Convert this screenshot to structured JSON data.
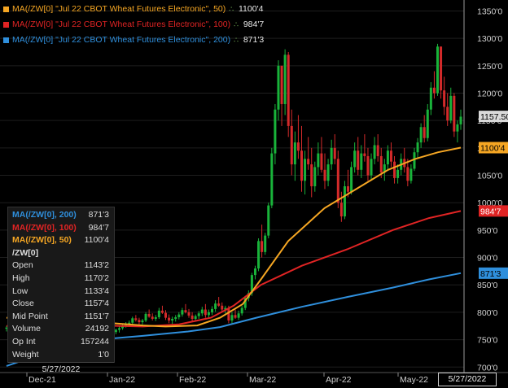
{
  "legend": [
    {
      "label": "MA(/ZW[0] \"Jul 22 CBOT Wheat Futures Electronic\", 50)",
      "value": "1100'4",
      "color": "#f5a623"
    },
    {
      "label": "MA(/ZW[0] \"Jul 22 CBOT Wheat Futures Electronic\", 100)",
      "value": "984'7",
      "color": "#e02424"
    },
    {
      "label": "MA(/ZW[0] \"Jul 22 CBOT Wheat Futures Electronic\", 200)",
      "value": "871'3",
      "color": "#2f8fdc"
    }
  ],
  "legend_icon": "settings-icon",
  "tooltip": {
    "ma200": {
      "label": "MA(/ZW[0], 200)",
      "value": "871'3",
      "color": "#2f8fdc"
    },
    "ma100": {
      "label": "MA(/ZW[0], 100)",
      "value": "984'7",
      "color": "#e02424"
    },
    "ma50": {
      "label": "MA(/ZW[0], 50)",
      "value": "1100'4",
      "color": "#f5a623"
    },
    "symbol": "/ZW[0]",
    "rows": [
      {
        "label": "Open",
        "value": "1143'2"
      },
      {
        "label": "High",
        "value": "1170'2"
      },
      {
        "label": "Low",
        "value": "1133'4"
      },
      {
        "label": "Close",
        "value": "1157'4"
      },
      {
        "label": "Mid Point",
        "value": "1151'7"
      },
      {
        "label": "Volume",
        "value": "24192"
      },
      {
        "label": "Op Int",
        "value": "157244"
      },
      {
        "label": "Weight",
        "value": "1'0"
      }
    ],
    "date": "5/27/2022"
  },
  "cursor_date": "5/27/2022",
  "chart_data": {
    "type": "candlestick",
    "y_ticks": [
      "700'0",
      "750'0",
      "800'0",
      "850'0",
      "900'0",
      "950'0",
      "1000'0",
      "1050'0",
      "1100'0",
      "1150'0",
      "1200'0",
      "1250'0",
      "1300'0",
      "1350'0"
    ],
    "ylim": [
      690,
      1370
    ],
    "x_ticks": [
      "Dec-21",
      "Jan-22",
      "Feb-22",
      "Mar-22",
      "Apr-22",
      "May-22"
    ],
    "price_tags": [
      {
        "label": "1157.50",
        "value": 1157.5,
        "color": "#d9d9d9",
        "text_color": "#000"
      },
      {
        "label": "1100'4",
        "value": 1100.5,
        "color": "#f5a623",
        "text_color": "#000"
      },
      {
        "label": "984'7",
        "value": 984.9,
        "color": "#e02424",
        "text_color": "#fff"
      },
      {
        "label": "871'3",
        "value": 871.4,
        "color": "#2f8fdc",
        "text_color": "#000"
      }
    ],
    "candles": [
      [
        770,
        775,
        765,
        772
      ],
      [
        772,
        778,
        768,
        775
      ],
      [
        775,
        780,
        770,
        773
      ],
      [
        773,
        776,
        768,
        771
      ],
      [
        771,
        777,
        767,
        774
      ],
      [
        774,
        782,
        771,
        779
      ],
      [
        779,
        784,
        774,
        776
      ],
      [
        776,
        781,
        771,
        778
      ],
      [
        778,
        786,
        776,
        783
      ],
      [
        783,
        787,
        776,
        779
      ],
      [
        779,
        784,
        772,
        775
      ],
      [
        775,
        780,
        770,
        777
      ],
      [
        777,
        779,
        766,
        768
      ],
      [
        768,
        773,
        762,
        771
      ],
      [
        771,
        777,
        768,
        775
      ],
      [
        775,
        779,
        768,
        770
      ],
      [
        770,
        774,
        760,
        762
      ],
      [
        762,
        770,
        758,
        768
      ],
      [
        768,
        775,
        764,
        772
      ],
      [
        772,
        776,
        762,
        765
      ],
      [
        765,
        768,
        752,
        755
      ],
      [
        755,
        762,
        750,
        760
      ],
      [
        760,
        766,
        755,
        763
      ],
      [
        763,
        770,
        760,
        766
      ],
      [
        766,
        770,
        756,
        758
      ],
      [
        758,
        764,
        752,
        761
      ],
      [
        761,
        768,
        758,
        765
      ],
      [
        765,
        772,
        762,
        769
      ],
      [
        769,
        772,
        760,
        763
      ],
      [
        763,
        770,
        760,
        767
      ],
      [
        767,
        771,
        752,
        755
      ],
      [
        755,
        760,
        748,
        758
      ],
      [
        758,
        766,
        755,
        764
      ],
      [
        764,
        770,
        760,
        768
      ],
      [
        768,
        774,
        763,
        771
      ],
      [
        771,
        778,
        768,
        775
      ],
      [
        775,
        782,
        772,
        779
      ],
      [
        779,
        785,
        775,
        781
      ],
      [
        781,
        792,
        778,
        789
      ],
      [
        789,
        795,
        783,
        786
      ],
      [
        786,
        790,
        778,
        782
      ],
      [
        782,
        788,
        778,
        785
      ],
      [
        785,
        800,
        782,
        797
      ],
      [
        797,
        805,
        790,
        792
      ],
      [
        792,
        798,
        785,
        788
      ],
      [
        788,
        795,
        784,
        791
      ],
      [
        791,
        808,
        788,
        803
      ],
      [
        803,
        812,
        797,
        799
      ],
      [
        799,
        804,
        786,
        790
      ],
      [
        790,
        796,
        780,
        785
      ],
      [
        785,
        792,
        778,
        788
      ],
      [
        788,
        795,
        783,
        791
      ],
      [
        791,
        800,
        787,
        796
      ],
      [
        796,
        808,
        792,
        804
      ],
      [
        804,
        815,
        798,
        800
      ],
      [
        800,
        806,
        790,
        794
      ],
      [
        794,
        800,
        784,
        788
      ],
      [
        788,
        796,
        783,
        793
      ],
      [
        793,
        802,
        788,
        798
      ],
      [
        798,
        810,
        793,
        805
      ],
      [
        805,
        815,
        790,
        795
      ],
      [
        795,
        805,
        788,
        800
      ],
      [
        800,
        811,
        795,
        806
      ],
      [
        806,
        822,
        801,
        816
      ],
      [
        816,
        828,
        810,
        812
      ],
      [
        812,
        818,
        800,
        805
      ],
      [
        805,
        812,
        798,
        808
      ],
      [
        808,
        812,
        780,
        785
      ],
      [
        785,
        800,
        780,
        795
      ],
      [
        795,
        805,
        788,
        790
      ],
      [
        790,
        803,
        786,
        798
      ],
      [
        798,
        812,
        794,
        808
      ],
      [
        808,
        830,
        804,
        826
      ],
      [
        826,
        840,
        820,
        835
      ],
      [
        835,
        872,
        830,
        868
      ],
      [
        868,
        885,
        860,
        880
      ],
      [
        880,
        935,
        875,
        930
      ],
      [
        930,
        960,
        900,
        910
      ],
      [
        910,
        945,
        905,
        940
      ],
      [
        940,
        1000,
        935,
        995
      ],
      [
        995,
        1100,
        990,
        1090
      ],
      [
        1090,
        1180,
        1070,
        1170
      ],
      [
        1170,
        1260,
        1150,
        1250
      ],
      [
        1250,
        1230,
        1140,
        1180
      ],
      [
        1180,
        1280,
        1160,
        1270
      ],
      [
        1270,
        1275,
        1120,
        1140
      ],
      [
        1140,
        1170,
        1050,
        1070
      ],
      [
        1070,
        1130,
        1040,
        1110
      ],
      [
        1110,
        1160,
        1080,
        1095
      ],
      [
        1095,
        1140,
        1020,
        1040
      ],
      [
        1040,
        1095,
        1015,
        1080
      ],
      [
        1080,
        1120,
        1060,
        1070
      ],
      [
        1070,
        1100,
        1010,
        1030
      ],
      [
        1030,
        1075,
        1020,
        1065
      ],
      [
        1065,
        1110,
        1050,
        1090
      ],
      [
        1090,
        1120,
        1055,
        1060
      ],
      [
        1060,
        1090,
        1025,
        1040
      ],
      [
        1040,
        1080,
        1030,
        1070
      ],
      [
        1070,
        1115,
        1060,
        1100
      ],
      [
        1100,
        1125,
        1070,
        1080
      ],
      [
        1080,
        1095,
        990,
        1000
      ],
      [
        1000,
        1020,
        965,
        975
      ],
      [
        975,
        1040,
        970,
        1030
      ],
      [
        1030,
        1060,
        1010,
        1020
      ],
      [
        1020,
        1075,
        1015,
        1065
      ],
      [
        1065,
        1110,
        1055,
        1095
      ],
      [
        1095,
        1120,
        1050,
        1060
      ],
      [
        1060,
        1105,
        1045,
        1090
      ],
      [
        1090,
        1125,
        1075,
        1085
      ],
      [
        1085,
        1100,
        1040,
        1050
      ],
      [
        1050,
        1090,
        1040,
        1080
      ],
      [
        1080,
        1120,
        1070,
        1105
      ],
      [
        1105,
        1125,
        1075,
        1085
      ],
      [
        1085,
        1100,
        1045,
        1055
      ],
      [
        1055,
        1080,
        1040,
        1070
      ],
      [
        1070,
        1105,
        1060,
        1095
      ],
      [
        1095,
        1110,
        1065,
        1075
      ],
      [
        1075,
        1085,
        1035,
        1045
      ],
      [
        1045,
        1070,
        1035,
        1060
      ],
      [
        1060,
        1090,
        1050,
        1080
      ],
      [
        1080,
        1100,
        1055,
        1065
      ],
      [
        1065,
        1080,
        1030,
        1040
      ],
      [
        1040,
        1070,
        1035,
        1062
      ],
      [
        1062,
        1100,
        1058,
        1092
      ],
      [
        1092,
        1118,
        1080,
        1110
      ],
      [
        1110,
        1145,
        1100,
        1138
      ],
      [
        1138,
        1160,
        1110,
        1118
      ],
      [
        1118,
        1180,
        1112,
        1170
      ],
      [
        1170,
        1220,
        1160,
        1210
      ],
      [
        1210,
        1240,
        1190,
        1200
      ],
      [
        1200,
        1290,
        1195,
        1285
      ],
      [
        1285,
        1282,
        1190,
        1205
      ],
      [
        1205,
        1230,
        1160,
        1175
      ],
      [
        1175,
        1200,
        1140,
        1150
      ],
      [
        1150,
        1210,
        1145,
        1195
      ],
      [
        1195,
        1200,
        1120,
        1130
      ],
      [
        1130,
        1150,
        1110,
        1143
      ],
      [
        1143,
        1170,
        1133,
        1157
      ]
    ],
    "ma50": [
      [
        0,
        790
      ],
      [
        0.1,
        785
      ],
      [
        0.2,
        782
      ],
      [
        0.3,
        776
      ],
      [
        0.35,
        774
      ],
      [
        0.42,
        776
      ],
      [
        0.47,
        790
      ],
      [
        0.52,
        815
      ],
      [
        0.56,
        860
      ],
      [
        0.62,
        930
      ],
      [
        0.7,
        990
      ],
      [
        0.78,
        1030
      ],
      [
        0.84,
        1060
      ],
      [
        0.9,
        1080
      ],
      [
        0.95,
        1092
      ],
      [
        1,
        1100.5
      ]
    ],
    "ma100": [
      [
        0,
        775
      ],
      [
        0.2,
        776
      ],
      [
        0.3,
        774
      ],
      [
        0.38,
        778
      ],
      [
        0.45,
        790
      ],
      [
        0.5,
        812
      ],
      [
        0.56,
        850
      ],
      [
        0.65,
        885
      ],
      [
        0.75,
        915
      ],
      [
        0.85,
        950
      ],
      [
        0.93,
        972
      ],
      [
        1,
        984.9
      ]
    ],
    "ma200": [
      [
        0,
        702
      ],
      [
        0.1,
        730
      ],
      [
        0.2,
        750
      ],
      [
        0.3,
        757
      ],
      [
        0.4,
        765
      ],
      [
        0.47,
        773
      ],
      [
        0.55,
        790
      ],
      [
        0.65,
        810
      ],
      [
        0.75,
        828
      ],
      [
        0.85,
        845
      ],
      [
        0.93,
        860
      ],
      [
        1,
        871.4
      ]
    ]
  }
}
